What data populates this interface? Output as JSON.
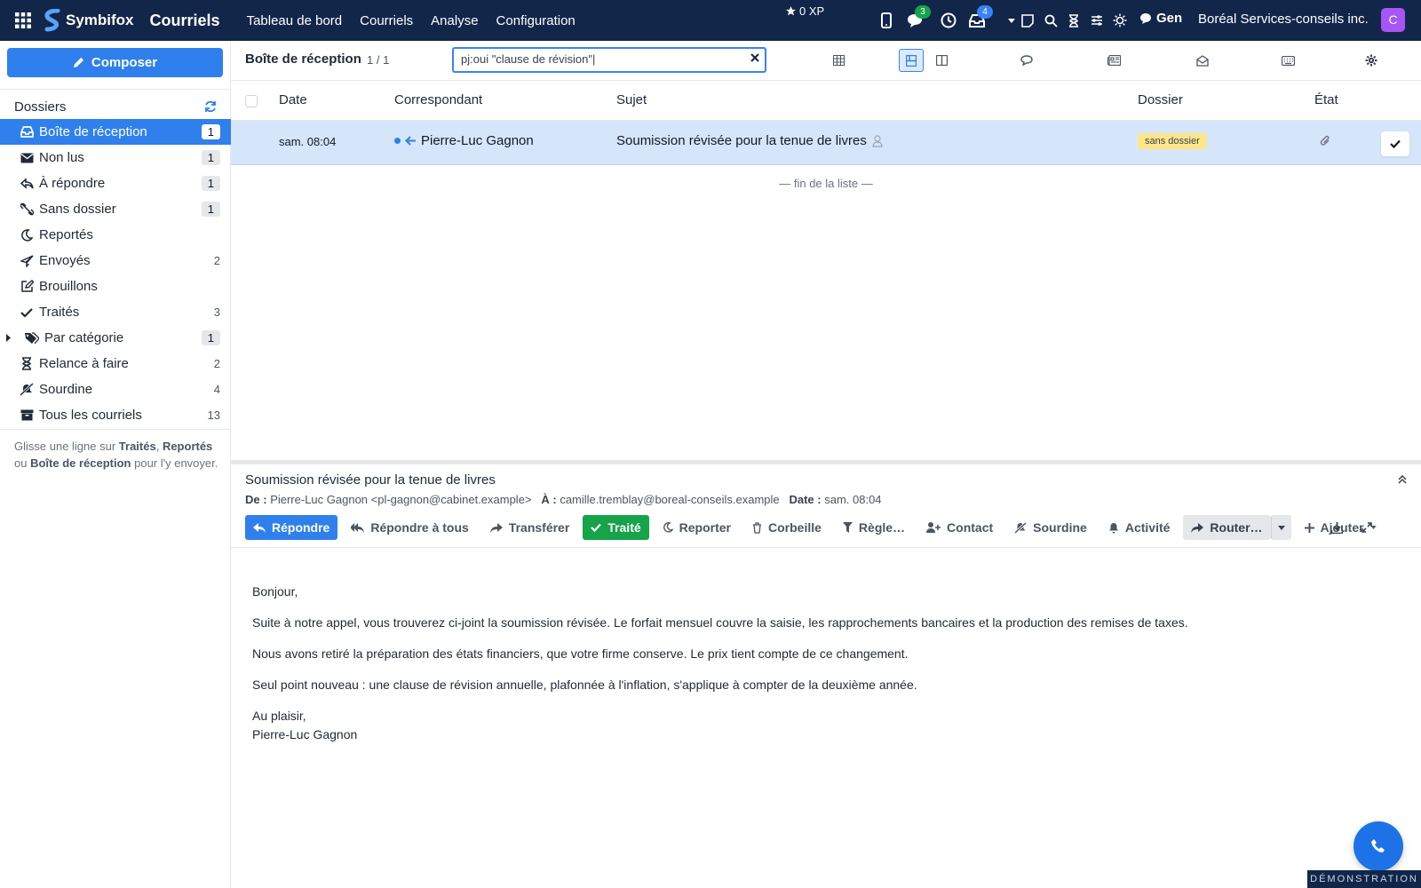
{
  "topnav": {
    "brand": "Symbifox",
    "module": "Courriels",
    "links": [
      "Tableau de bord",
      "Courriels",
      "Analyse",
      "Configuration"
    ],
    "xp": "0 XP",
    "chat_badge": "3",
    "inbox_badge": "4",
    "status": "Gen",
    "company": "Boréal Services-conseils inc.",
    "avatar_letter": "C"
  },
  "sidebar": {
    "compose_label": "Composer",
    "folders_title": "Dossiers",
    "folders": [
      {
        "label": "Boîte de réception",
        "count": "1",
        "icon": "inbox-icon"
      },
      {
        "label": "Non lus",
        "count": "1",
        "icon": "envelope-icon"
      },
      {
        "label": "À répondre",
        "count": "1",
        "icon": "reply-icon"
      },
      {
        "label": "Sans dossier",
        "count": "1",
        "icon": "unlink-icon"
      },
      {
        "label": "Reportés",
        "count": "",
        "icon": "moon-icon"
      },
      {
        "label": "Envoyés",
        "count": "2",
        "icon": "paper-plane-icon"
      },
      {
        "label": "Brouillons",
        "count": "",
        "icon": "edit-icon"
      },
      {
        "label": "Traités",
        "count": "3",
        "icon": "check-icon"
      },
      {
        "label": "Par catégorie",
        "count": "1",
        "icon": "tags-icon"
      },
      {
        "label": "Relance à faire",
        "count": "2",
        "icon": "hourglass-icon"
      },
      {
        "label": "Sourdine",
        "count": "4",
        "icon": "mute-icon"
      },
      {
        "label": "Tous les courriels",
        "count": "13",
        "icon": "archive-icon"
      }
    ],
    "hint_1": "Glisse une ligne sur ",
    "hint_b1": "Traités",
    "hint_2": ", ",
    "hint_b2": "Reportés",
    "hint_3": " ou ",
    "hint_b3": "Boîte de réception",
    "hint_4": " pour l'y envoyer."
  },
  "list": {
    "title": "Boîte de réception",
    "count": "1 / 1",
    "search_value": "pj:oui \"clause de révision\"|",
    "columns": {
      "date": "Date",
      "from": "Correspondant",
      "subject": "Sujet",
      "folder": "Dossier",
      "state": "État"
    },
    "rows": [
      {
        "date": "sam. 08:04",
        "from": "Pierre-Luc Gagnon",
        "subject": "Soumission révisée pour la tenue de livres",
        "folder": "sans dossier"
      }
    ],
    "end_of_list": "— fin de la liste —"
  },
  "preview": {
    "subject": "Soumission révisée pour la tenue de livres",
    "from_label": "De :",
    "from": "Pierre-Luc Gagnon <pl-gagnon@cabinet.example>",
    "to_label": "À :",
    "to": "camille.tremblay@boreal-conseils.example",
    "date_label": "Date :",
    "date": "sam. 08:04",
    "actions": {
      "reply": "Répondre",
      "reply_all": "Répondre à tous",
      "forward": "Transférer",
      "done": "Traité",
      "snooze": "Reporter",
      "trash": "Corbeille",
      "rule": "Règle…",
      "contact": "Contact",
      "mute": "Sourdine",
      "activity": "Activité",
      "route": "Router…",
      "add": "Ajouter"
    },
    "body": [
      "Bonjour,",
      "Suite à notre appel, vous trouverez ci-joint la soumission révisée. Le forfait mensuel couvre la saisie, les rapprochements bancaires et la production des remises de taxes.",
      "Nous avons retiré la préparation des états financiers, que votre firme conserve. Le prix tient compte de ce changement.",
      "Seul point nouveau : une clause de révision annuelle, plafonnée à l'inflation, s'applique à compter de la deuxième année."
    ],
    "signoff": "Au plaisir,",
    "signature": "Pierre-Luc Gagnon"
  },
  "footer": {
    "demo": "DÉMONSTRATION"
  },
  "colors": {
    "nav": "#12264a",
    "accent": "#2f80ed",
    "success": "#16a34a",
    "row_selected": "#d6e6fa",
    "tag": "#fde68a"
  }
}
